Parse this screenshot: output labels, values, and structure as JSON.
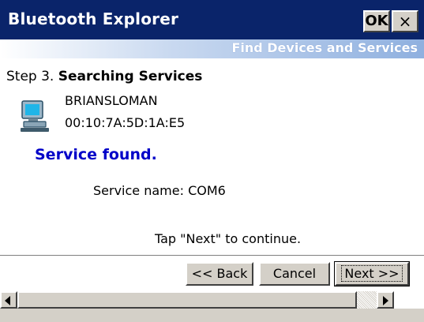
{
  "window": {
    "title": "Bluetooth Explorer",
    "ok_label": "OK",
    "close_label": "×"
  },
  "header": {
    "subtitle": "Find Devices and Services"
  },
  "step": {
    "prefix": "Step 3.",
    "title": "Searching Services"
  },
  "device": {
    "icon": "computer-icon",
    "name": "BRIANSLOMAN",
    "address": "00:10:7A:5D:1A:E5"
  },
  "status": {
    "message": "Service found.",
    "service_line": "Service name: COM6",
    "hint": "Tap \"Next\" to continue."
  },
  "buttons": {
    "back": "<< Back",
    "cancel": "Cancel",
    "next": "Next >>"
  },
  "colors": {
    "titlebar": "#0a246a",
    "status_text": "#0000c8",
    "button_face": "#d4d0c8"
  }
}
